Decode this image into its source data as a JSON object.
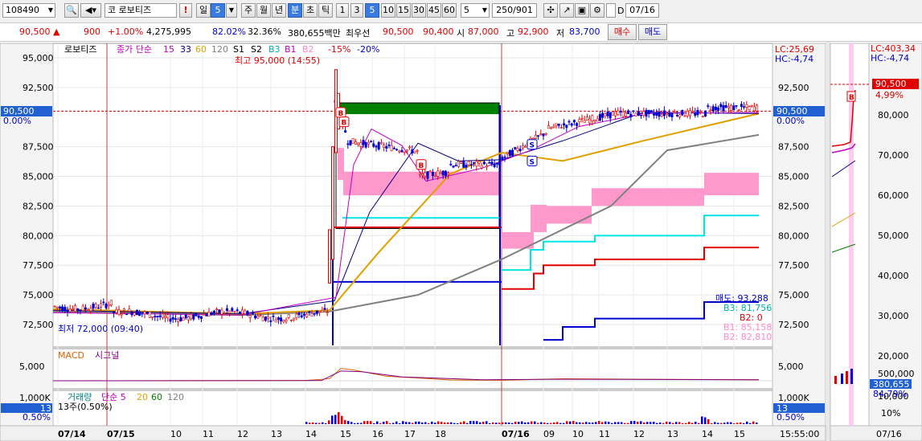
{
  "toolbar": {
    "code": "108490",
    "market": "코",
    "name": "로보티즈",
    "warn": "!",
    "periods": [
      "일",
      "5",
      "주",
      "월",
      "년",
      "분",
      "초",
      "틱"
    ],
    "minutes": [
      "1",
      "3",
      "5",
      "10",
      "15",
      "30",
      "45",
      "60"
    ],
    "period_value": "5",
    "count": "250/901",
    "date_checkbox": "D",
    "date": "07/16"
  },
  "info": {
    "price": "90,500",
    "change": "900",
    "change_pct": "+1.00%",
    "volume": "4,275,995",
    "ratio1": "82.02%",
    "ratio2": "32.36%",
    "amount": "380,655백만",
    "priority": "최우선",
    "ask": "90,500",
    "bid": "90,400",
    "open_label": "시",
    "open": "87,000",
    "high_label": "고",
    "high": "92,900",
    "low_label": "저",
    "low": "83,700",
    "sell": "매수",
    "buy": "매도"
  },
  "chart": {
    "name_tag": "로보티즈",
    "ma_legend": {
      "label": "종가 단순",
      "periods": [
        "15",
        "33",
        "60",
        "120"
      ]
    },
    "signals": [
      "S1",
      "S2",
      "B3",
      "B1",
      "B2"
    ],
    "pcts": [
      "-15%",
      "-20%"
    ],
    "high_annot": "최고 95,000 (14:55)",
    "low_annot": "최저 72,000 (09:40)",
    "lc": "LC:25,69",
    "hc": "HC:-4,74",
    "right_price": "90,500",
    "right_pct": "0.00%",
    "left_price": "90,500",
    "left_pct": "0.00%",
    "price_ticks": [
      "95,000",
      "92,500",
      "87,500",
      "85,000",
      "82,500",
      "80,000",
      "77,500",
      "75,000",
      "72,500"
    ],
    "right_ticks": [
      "92,500",
      "87,500",
      "85,000",
      "82,500",
      "80,000",
      "77,500",
      "75,000",
      "72,500"
    ],
    "sig_lines": [
      "매도: 93,288",
      "B3: 81,756",
      "B2: 0",
      "B1: 85,158",
      "B2: 82,810"
    ],
    "markers": [
      "B",
      "B",
      "B",
      "S",
      "S"
    ],
    "macd_label": "MACD",
    "signal_label": "시그널",
    "macd_tick": "5,000",
    "vol_label": "거래량",
    "vol_ma": [
      "단순 5",
      "20",
      "60",
      "120"
    ],
    "vol_note": "13주(0.50%)",
    "vol_tick": "1,000K",
    "vol_value": "13",
    "vol_pct": "0.50%",
    "x_labels": [
      "07/14",
      "07/15",
      "10",
      "11",
      "12",
      "13",
      "14",
      "15",
      "16",
      "17",
      "18",
      "07/16",
      "09",
      "10",
      "11",
      "12",
      "13",
      "14",
      "15"
    ],
    "time_end": "15:55:00"
  },
  "mini": {
    "lc": "LC:403,34",
    "hc": "HC:-4,74",
    "price": "90,500",
    "pct": "4,99%",
    "ticks": [
      "80,000",
      "70,000",
      "60,000",
      "50,000",
      "40,000",
      "30,000",
      "20,000",
      "10,000"
    ],
    "vol_ticks": [
      "500,000",
      "10%"
    ],
    "vol_value": "380,655",
    "vol_pct": "84,79%",
    "date": "07/16",
    "marker": "B"
  },
  "colors": {
    "up": "#e00000",
    "down": "#0000d0",
    "ma15": "#c000c0",
    "ma33": "#000080",
    "ma60": "#e0a000",
    "ma120": "#808080",
    "cloud": "#ff99cc",
    "cyan": "#00e5e5",
    "green": "#008000"
  }
}
